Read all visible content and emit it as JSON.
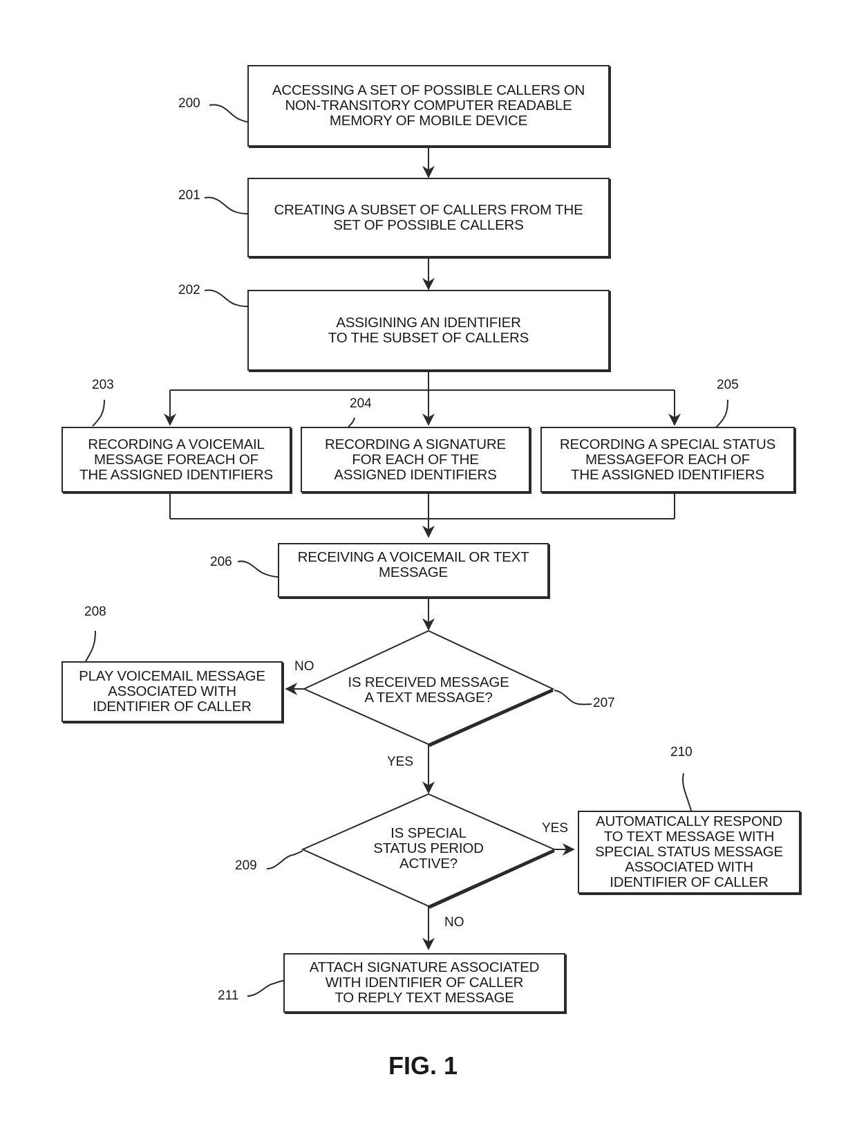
{
  "figure": {
    "title": "FIG. 1"
  },
  "steps": {
    "s200": {
      "ref": "200",
      "text": "ACCESSING A SET OF POSSIBLE CALLERS ON\nNON-TRANSITORY COMPUTER READABLE\nMEMORY OF MOBILE DEVICE"
    },
    "s201": {
      "ref": "201",
      "text": "CREATING A SUBSET OF CALLERS FROM THE\nSET OF POSSIBLE CALLERS"
    },
    "s202": {
      "ref": "202",
      "text": "ASSIGINING AN IDENTIFIER\nTO THE SUBSET OF CALLERS"
    },
    "s203": {
      "ref": "203",
      "text": "RECORDING  A VOICEMAIL\nMESSAGE FOREACH OF\nTHE ASSIGNED IDENTIFIERS"
    },
    "s204": {
      "ref": "204",
      "text": "RECORDING A SIGNATURE\nFOR EACH OF THE\nASSIGNED IDENTIFIERS"
    },
    "s205": {
      "ref": "205",
      "text": "RECORDING A SPECIAL STATUS\nMESSAGEFOR EACH OF\nTHE ASSIGNED IDENTIFIERS"
    },
    "s206": {
      "ref": "206",
      "text": "RECEIVING A VOICEMAIL OR TEXT\nMESSAGE"
    },
    "s207": {
      "ref": "207",
      "text": "IS RECEIVED MESSAGE\nA TEXT MESSAGE?"
    },
    "s208": {
      "ref": "208",
      "text": "PLAY VOICEMAIL MESSAGE\nASSOCIATED WITH\nIDENTIFIER OF CALLER"
    },
    "s209": {
      "ref": "209",
      "text": "IS SPECIAL\nSTATUS PERIOD\nACTIVE?"
    },
    "s210": {
      "ref": "210",
      "text": "AUTOMATICALLY RESPOND\nTO TEXT MESSAGE WITH\nSPECIAL STATUS MESSAGE\nASSOCIATED WITH\nIDENTIFIER OF CALLER"
    },
    "s211": {
      "ref": "211",
      "text": "ATTACH SIGNATURE ASSOCIATED\nWITH IDENTIFIER OF CALLER\nTO REPLY TEXT MESSAGE"
    }
  },
  "edge_labels": {
    "d207_no": "NO",
    "d207_yes": "YES",
    "d209_yes": "YES",
    "d209_no": "NO"
  },
  "edges": [
    {
      "from": "200",
      "to": "201"
    },
    {
      "from": "201",
      "to": "202"
    },
    {
      "from": "202",
      "to": "203"
    },
    {
      "from": "202",
      "to": "204"
    },
    {
      "from": "202",
      "to": "205"
    },
    {
      "from": "203",
      "to": "206"
    },
    {
      "from": "204",
      "to": "206"
    },
    {
      "from": "205",
      "to": "206"
    },
    {
      "from": "206",
      "to": "207"
    },
    {
      "from": "207",
      "to": "208",
      "label": "NO"
    },
    {
      "from": "207",
      "to": "209",
      "label": "YES"
    },
    {
      "from": "209",
      "to": "210",
      "label": "YES"
    },
    {
      "from": "209",
      "to": "211",
      "label": "NO"
    }
  ]
}
